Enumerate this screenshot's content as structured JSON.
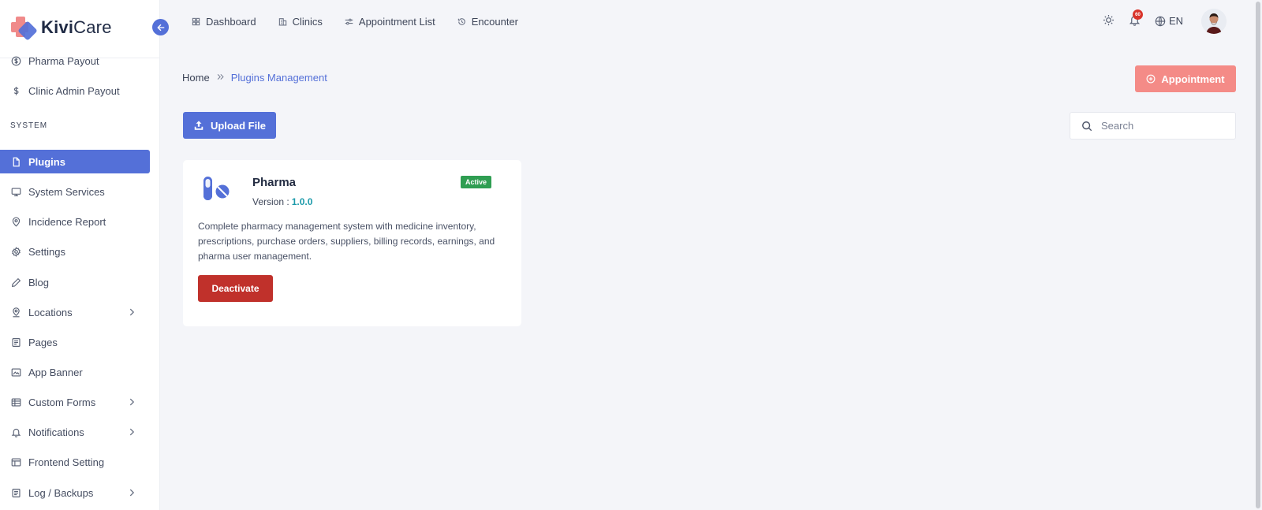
{
  "brand": {
    "logo_bold": "Kivi",
    "logo_regular": "Care"
  },
  "sidebar": {
    "section_label": "SYSTEM",
    "items": [
      {
        "label": "Pharma Payout",
        "icon": "dollar-circle-icon"
      },
      {
        "label": "Clinic Admin Payout",
        "icon": "dollar-icon"
      },
      {
        "label": "Plugins",
        "icon": "file-icon",
        "active": true
      },
      {
        "label": "System Services",
        "icon": "monitor-icon"
      },
      {
        "label": "Incidence Report",
        "icon": "map-pin-icon"
      },
      {
        "label": "Settings",
        "icon": "gear-icon"
      },
      {
        "label": "Blog",
        "icon": "pencil-icon"
      },
      {
        "label": "Locations",
        "icon": "location-icon",
        "expandable": true
      },
      {
        "label": "Pages",
        "icon": "page-icon"
      },
      {
        "label": "App Banner",
        "icon": "image-icon"
      },
      {
        "label": "Custom Forms",
        "icon": "form-icon",
        "expandable": true
      },
      {
        "label": "Notifications",
        "icon": "bell-icon",
        "expandable": true
      },
      {
        "label": "Frontend Setting",
        "icon": "layout-icon"
      },
      {
        "label": "Log / Backups",
        "icon": "log-icon",
        "expandable": true
      }
    ]
  },
  "topnav": {
    "items": [
      {
        "label": "Dashboard",
        "icon": "grid-icon"
      },
      {
        "label": "Clinics",
        "icon": "building-icon"
      },
      {
        "label": "Appointment List",
        "icon": "sliders-icon"
      },
      {
        "label": "Encounter",
        "icon": "history-icon"
      }
    ],
    "notification_count": "60",
    "language": "EN"
  },
  "breadcrumb": {
    "home": "Home",
    "current": "Plugins Management"
  },
  "actions": {
    "appointment_label": "Appointment",
    "upload_label": "Upload File"
  },
  "search": {
    "placeholder": "Search",
    "value": ""
  },
  "plugin": {
    "name": "Pharma",
    "version_label": "Version :",
    "version": "1.0.0",
    "status": "Active",
    "description": "Complete pharmacy management system with medicine inventory, prescriptions, purchase orders, suppliers, billing records, earnings, and pharma user management.",
    "action_label": "Deactivate"
  },
  "colors": {
    "primary": "#5470d8",
    "accent": "#f48b87",
    "danger": "#c0312b",
    "success": "#2f9e52",
    "version": "#1b9aaa"
  }
}
